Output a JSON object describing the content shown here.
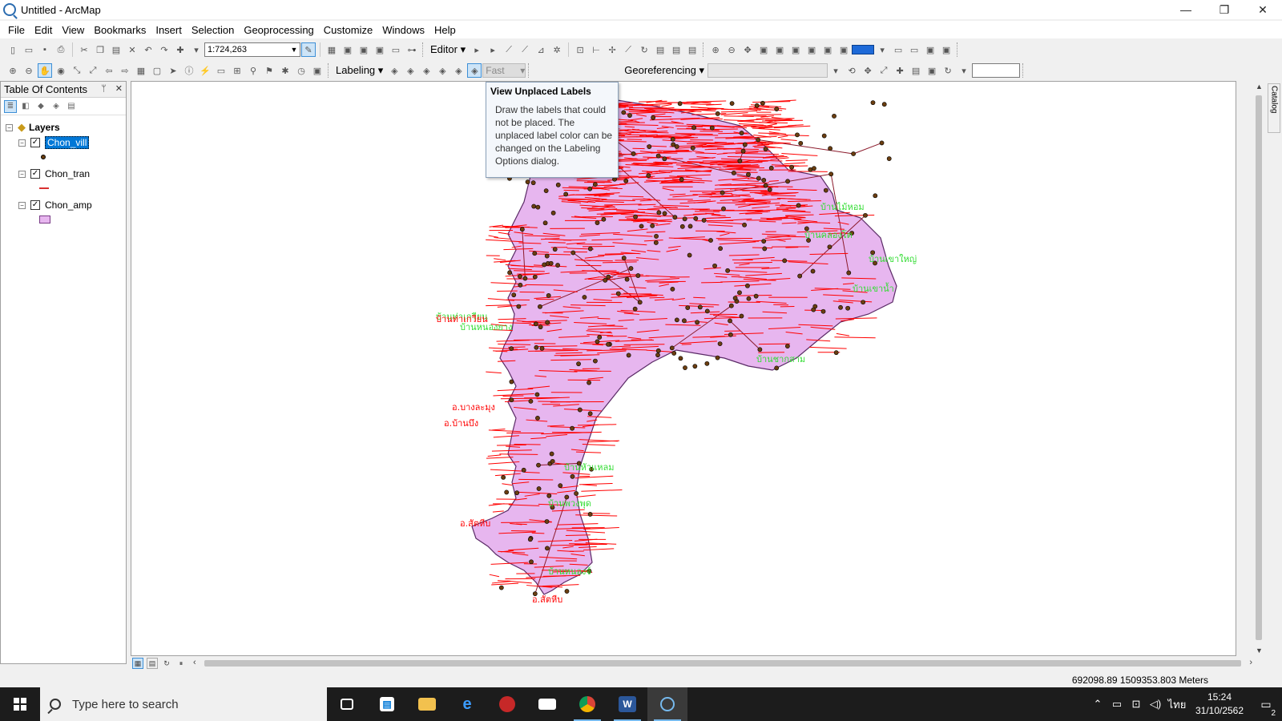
{
  "window": {
    "title": "Untitled - ArcMap",
    "min": "—",
    "restore": "❐",
    "close": "✕"
  },
  "menu": [
    "File",
    "Edit",
    "View",
    "Bookmarks",
    "Insert",
    "Selection",
    "Geoprocessing",
    "Customize",
    "Windows",
    "Help"
  ],
  "toolbar": {
    "scale_value": "1:724,263",
    "editor_label": "Editor ▾",
    "labeling_label": "Labeling ▾",
    "label_mode": "Fast",
    "georef_label": "Georeferencing ▾"
  },
  "toc": {
    "title": "Table Of Contents",
    "pin": "ᛘ",
    "close": "✕",
    "root": "Layers",
    "layers": [
      {
        "name": "Chon_vill",
        "symbol": "point"
      },
      {
        "name": "Chon_tran",
        "symbol": "line"
      },
      {
        "name": "Chon_amp",
        "symbol": "polygon"
      }
    ]
  },
  "tooltip": {
    "title": "View Unplaced Labels",
    "body": "Draw the labels that could not be placed. The unplaced label color can be changed on the Labeling Options dialog."
  },
  "map": {
    "polygon_fill": "#e7b6ef",
    "polygon_stroke": "#5a2a66",
    "road_color": "#8b1a2b",
    "unplaced_color": "#ff0000",
    "placed_label_color": "#33dd33",
    "village_color": "#6b3e10",
    "green_labels": [
      "บ้านไม้หอม",
      "บ้านคลองโต",
      "บ้านเขาใหญ่",
      "บ้านเขาน้ำ",
      "บ้านชากสาม",
      "บ้านท่าเกวียน",
      "บ้านหนองยาง",
      "บ้านหัวแหลม",
      "บ้านพวงพุด",
      "บ้านหนองจ์"
    ],
    "red_labels": [
      "อ.บางละมุง",
      "อ.สัตหีบ",
      "บ้านท่าเกวียน",
      "อ.สัตหีบ",
      "อ.บ้านบึง"
    ]
  },
  "catalog_tab": "Catalog",
  "status": {
    "coordinates": "692098.89  1509353.803 Meters"
  },
  "taskbar": {
    "search_placeholder": "Type here to search",
    "time": "15:24",
    "date": "31/10/2562",
    "lang": "ไทย",
    "notifications": "2"
  }
}
